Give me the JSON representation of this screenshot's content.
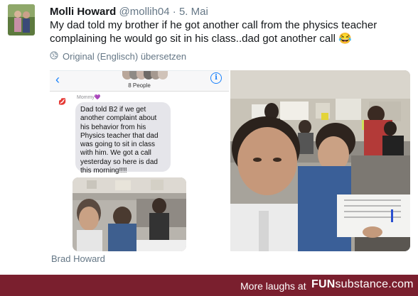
{
  "tweet": {
    "author_name": "Molli Howard",
    "handle": "@mollih04",
    "separator": "·",
    "date": "5. Mai",
    "text": "My dad told my brother if he got another call from the physics teacher complaining he would go sit in his class..dad got another call 😂",
    "translate_label": "Original (Englisch) übersetzen"
  },
  "imessage": {
    "group_label": "8 People",
    "sender": "Mommy💜",
    "message": "Dad told B2 if we get another complaint about his behavior from his Physics teacher that dad was going to sit in class with him. We got a call yesterday so here is dad this morning!!!!"
  },
  "caption": "Brad Howard",
  "footer": {
    "text": "More laughs at",
    "logo_fun": "FUN",
    "logo_substance": "substance",
    "logo_com": ".com"
  },
  "icons": [
    "globe-icon",
    "back-chevron-icon",
    "info-icon",
    "lips-icon"
  ],
  "colors": {
    "footer_bg": "#7a1f2e",
    "imessage_blue": "#1a82fb",
    "bubble_grey": "#e5e5ea",
    "meta_grey": "#657786"
  }
}
